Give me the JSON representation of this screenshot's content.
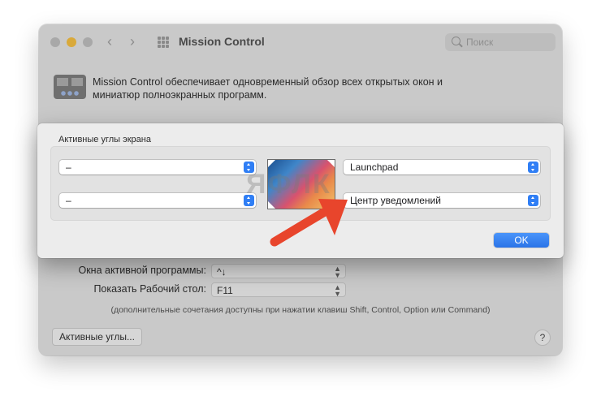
{
  "window": {
    "title": "Mission Control",
    "search_placeholder": "Поиск",
    "description": "Mission Control обеспечивает одновременный обзор всех открытых окон и миниатюр полноэкранных программ."
  },
  "shortcuts": {
    "app_windows_label": "Окна активной программы:",
    "app_windows_value": "^↓",
    "show_desktop_label": "Показать Рабочий стол:",
    "show_desktop_value": "F11",
    "note": "(дополнительные сочетания доступны при нажатии клавиш Shift, Control, Option или Command)",
    "hot_corners_button": "Активные углы...",
    "help_button": "?"
  },
  "sheet": {
    "title": "Активные углы экрана",
    "top_left": "–",
    "bottom_left": "–",
    "top_right": "Launchpad",
    "bottom_right": "Центр уведомлений",
    "ok_button": "OK"
  },
  "watermark": "ЯФЛК",
  "accent_color": "#2f7ef5",
  "annotation_arrow_color": "#e8452c"
}
